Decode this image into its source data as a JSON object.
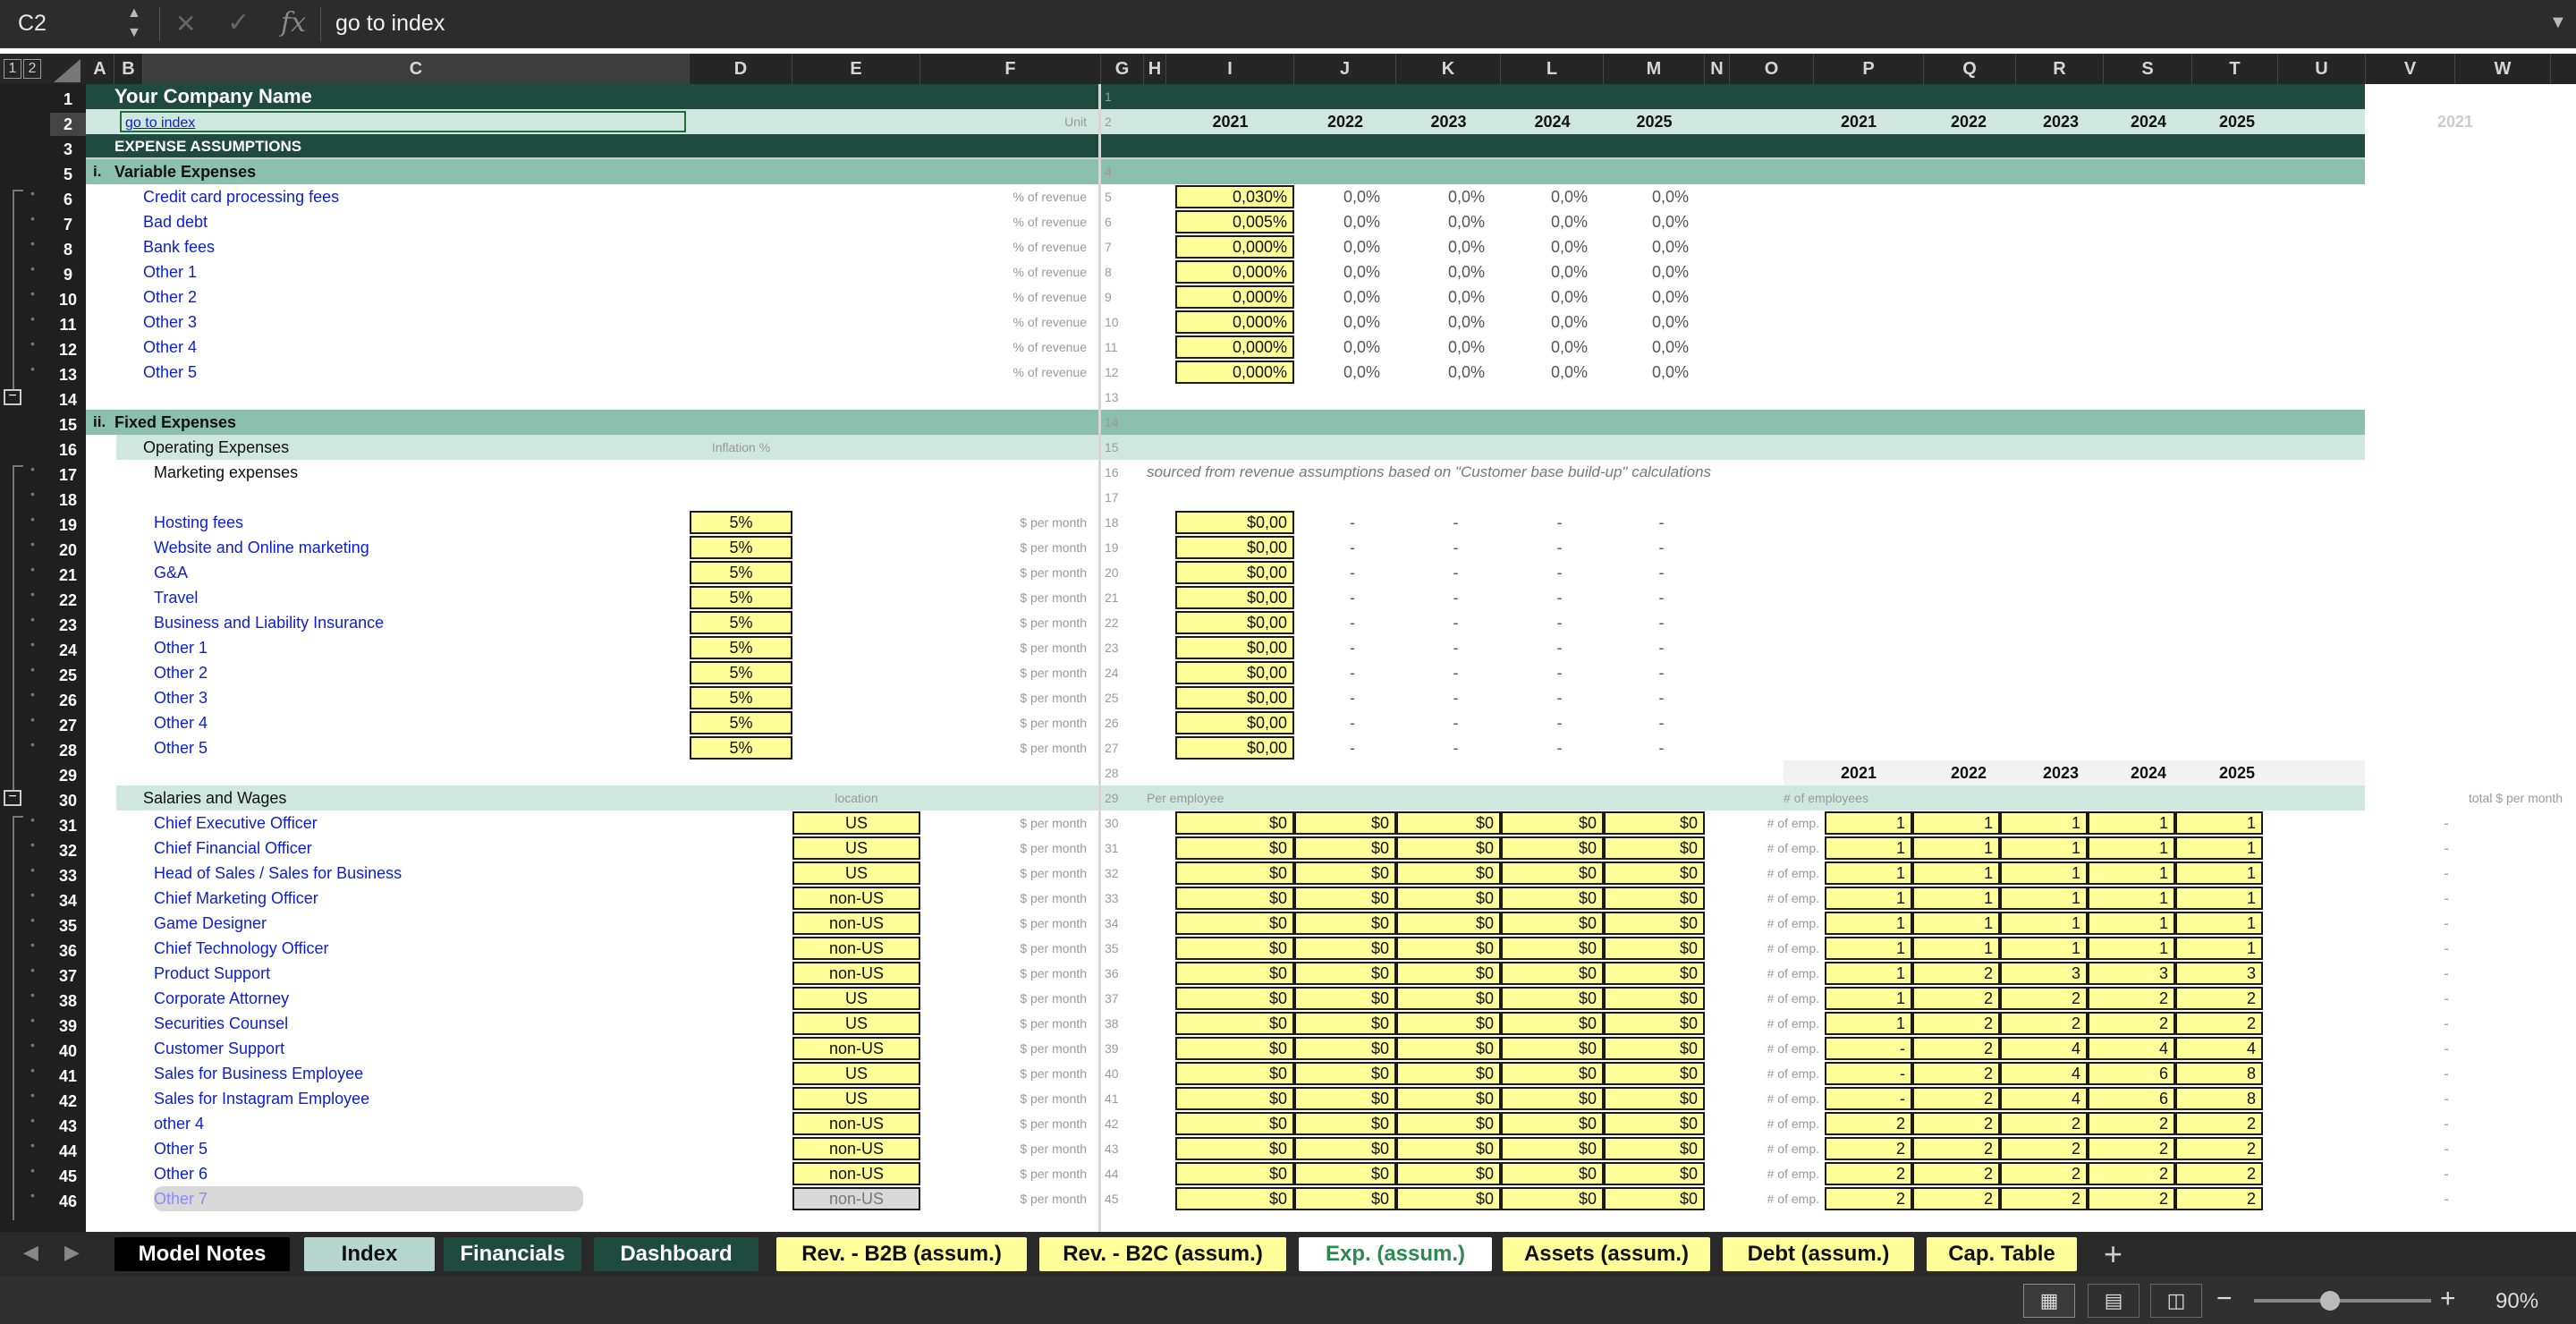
{
  "formula_bar": {
    "name_box": "C2",
    "formula": "go to index",
    "fx": "fx"
  },
  "columns": [
    "A",
    "B",
    "C",
    "D",
    "E",
    "F",
    "G",
    "H",
    "I",
    "J",
    "K",
    "L",
    "M",
    "N",
    "O",
    "P",
    "Q",
    "R",
    "S",
    "T",
    "U",
    "V",
    "W"
  ],
  "outline_levels": [
    "1",
    "2"
  ],
  "header": {
    "company": "Your Company Name",
    "link": "go to index",
    "unit": "Unit",
    "years": [
      "2021",
      "2022",
      "2023",
      "2024",
      "2025"
    ],
    "years_right": [
      "2021",
      "2022",
      "2023",
      "2024",
      "2025"
    ],
    "year_far": "2021",
    "title": "EXPENSE ASSUMPTIONS"
  },
  "variable": {
    "section": "Variable Expenses",
    "roman": "i.",
    "unit": "% of revenue",
    "rows": [
      {
        "label": "Credit card processing fees",
        "val": "0,030%"
      },
      {
        "label": "Bad debt",
        "val": "0,005%"
      },
      {
        "label": "Bank fees",
        "val": "0,000%"
      },
      {
        "label": "Other 1",
        "val": "0,000%"
      },
      {
        "label": "Other 2",
        "val": "0,000%"
      },
      {
        "label": "Other 3",
        "val": "0,000%"
      },
      {
        "label": "Other 4",
        "val": "0,000%"
      },
      {
        "label": "Other 5",
        "val": "0,000%"
      }
    ],
    "proj": "0,0%"
  },
  "fixed": {
    "section": "Fixed Expenses",
    "roman": "ii.",
    "opex": "Operating Expenses",
    "inflation": "Inflation %",
    "marketing": "Marketing expenses",
    "marketing_note": "sourced from revenue assumptions based on \"Customer base build-up\" calculations",
    "unit": "$ per month",
    "rows": [
      {
        "label": "Hosting fees",
        "infl": "5%",
        "val": "$0,00"
      },
      {
        "label": "Website and Online marketing",
        "infl": "5%",
        "val": "$0,00"
      },
      {
        "label": "G&A",
        "infl": "5%",
        "val": "$0,00"
      },
      {
        "label": "Travel",
        "infl": "5%",
        "val": "$0,00"
      },
      {
        "label": "Business and Liability Insurance",
        "infl": "5%",
        "val": "$0,00"
      },
      {
        "label": "Other 1",
        "infl": "5%",
        "val": "$0,00"
      },
      {
        "label": "Other 2",
        "infl": "5%",
        "val": "$0,00"
      },
      {
        "label": "Other 3",
        "infl": "5%",
        "val": "$0,00"
      },
      {
        "label": "Other 4",
        "infl": "5%",
        "val": "$0,00"
      },
      {
        "label": "Other 5",
        "infl": "5%",
        "val": "$0,00"
      }
    ],
    "dash": "-"
  },
  "salaries": {
    "title": "Salaries and Wages",
    "location": "location",
    "per_employee": "Per employee",
    "num_employees": "# of employees",
    "total": "total $ per month",
    "unit": "$ per month",
    "emp_unit": "# of emp.",
    "money": "$0",
    "dash": "-",
    "rows": [
      {
        "label": "Chief Executive Officer",
        "loc": "US",
        "emp": [
          "1",
          "1",
          "1",
          "1",
          "1"
        ]
      },
      {
        "label": "Chief Financial Officer",
        "loc": "US",
        "emp": [
          "1",
          "1",
          "1",
          "1",
          "1"
        ]
      },
      {
        "label": "Head of Sales / Sales for Business",
        "loc": "US",
        "emp": [
          "1",
          "1",
          "1",
          "1",
          "1"
        ]
      },
      {
        "label": "Chief Marketing Officer",
        "loc": "non-US",
        "emp": [
          "1",
          "1",
          "1",
          "1",
          "1"
        ]
      },
      {
        "label": "Game Designer",
        "loc": "non-US",
        "emp": [
          "1",
          "1",
          "1",
          "1",
          "1"
        ]
      },
      {
        "label": "Chief Technology Officer",
        "loc": "non-US",
        "emp": [
          "1",
          "1",
          "1",
          "1",
          "1"
        ]
      },
      {
        "label": "Product Support",
        "loc": "non-US",
        "emp": [
          "1",
          "2",
          "3",
          "3",
          "3"
        ]
      },
      {
        "label": "Corporate Attorney",
        "loc": "US",
        "emp": [
          "1",
          "2",
          "2",
          "2",
          "2"
        ]
      },
      {
        "label": "Securities Counsel",
        "loc": "US",
        "emp": [
          "1",
          "2",
          "2",
          "2",
          "2"
        ]
      },
      {
        "label": "Customer Support",
        "loc": "non-US",
        "emp": [
          "-",
          "2",
          "4",
          "4",
          "4"
        ]
      },
      {
        "label": "Sales for Business Employee",
        "loc": "US",
        "emp": [
          "-",
          "2",
          "4",
          "6",
          "8"
        ]
      },
      {
        "label": "Sales for  Instagram Employee",
        "loc": "US",
        "emp": [
          "-",
          "2",
          "4",
          "6",
          "8"
        ]
      },
      {
        "label": "other 4",
        "loc": "non-US",
        "emp": [
          "2",
          "2",
          "2",
          "2",
          "2"
        ]
      },
      {
        "label": "Other 5",
        "loc": "non-US",
        "emp": [
          "2",
          "2",
          "2",
          "2",
          "2"
        ]
      },
      {
        "label": "Other 6",
        "loc": "non-US",
        "emp": [
          "2",
          "2",
          "2",
          "2",
          "2"
        ]
      },
      {
        "label": "Other 7",
        "loc": "non-US",
        "emp": [
          "2",
          "2",
          "2",
          "2",
          "2"
        ]
      }
    ]
  },
  "rows_visible": [
    "1",
    "2",
    "3",
    "5",
    "6",
    "7",
    "8",
    "9",
    "10",
    "11",
    "12",
    "13",
    "14",
    "15",
    "16",
    "17",
    "18",
    "19",
    "20",
    "21",
    "22",
    "23",
    "24",
    "25",
    "26",
    "27",
    "28",
    "29",
    "30",
    "31",
    "32",
    "33",
    "34",
    "35",
    "36",
    "37",
    "38",
    "39",
    "40",
    "41",
    "42",
    "43",
    "44",
    "45",
    "46"
  ],
  "g_numbers": [
    "1",
    "2",
    "",
    "4",
    "5",
    "6",
    "7",
    "8",
    "9",
    "10",
    "11",
    "12",
    "13",
    "14",
    "15",
    "16",
    "17",
    "18",
    "19",
    "20",
    "21",
    "22",
    "23",
    "24",
    "25",
    "26",
    "27",
    "28",
    "29",
    "30",
    "31",
    "32",
    "33",
    "34",
    "35",
    "36",
    "37",
    "38",
    "39",
    "40",
    "41",
    "42",
    "43",
    "44",
    "45"
  ],
  "tabs": [
    {
      "label": "Model Notes",
      "style": "black"
    },
    {
      "label": "Index",
      "style": "light"
    },
    {
      "label": "Financials",
      "style": "dark"
    },
    {
      "label": "Dashboard",
      "style": "dark"
    },
    {
      "label": "Rev. - B2B (assum.)",
      "style": "yellow"
    },
    {
      "label": "Rev. - B2C (assum.)",
      "style": "yellow"
    },
    {
      "label": "Exp. (assum.)",
      "style": "active"
    },
    {
      "label": "Assets (assum.)",
      "style": "yellow"
    },
    {
      "label": "Debt (assum.)",
      "style": "yellow"
    },
    {
      "label": "Cap. Table",
      "style": "yellow"
    }
  ],
  "add_sheet": "+",
  "zoom": "90%",
  "colors": {
    "dark_green": "#1f4a40",
    "mid_green": "#8bbfae",
    "light_green": "#d0e7e0",
    "yellow": "#ffff99",
    "blue_text": "#0b1fd0"
  }
}
